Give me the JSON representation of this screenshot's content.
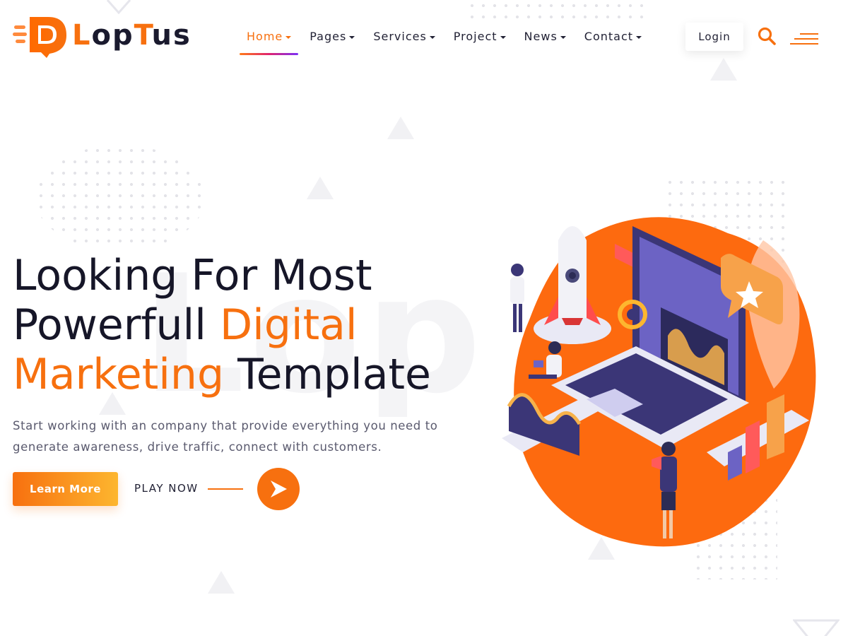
{
  "brand": {
    "name_prefix": "L",
    "name_accent": "o",
    "name_suffix": "pTus",
    "accent_color": "#f7700f"
  },
  "nav": {
    "items": [
      {
        "label": "Home",
        "active": true
      },
      {
        "label": "Pages",
        "active": false
      },
      {
        "label": "Services",
        "active": false
      },
      {
        "label": "Project",
        "active": false
      },
      {
        "label": "News",
        "active": false
      },
      {
        "label": "Contact",
        "active": false
      }
    ]
  },
  "header": {
    "login_label": "Login",
    "search_icon": "search-icon",
    "menu_icon": "hamburger-menu-icon"
  },
  "hero": {
    "title_line1": "Looking For Most",
    "title_line2_plain": "Powerfull ",
    "title_line2_accent": "Digital",
    "title_line3_accent": "Marketing",
    "title_line3_plain": " Template",
    "description": "Start working with an company that provide everything you need to generate awareness, drive traffic, connect with customers.",
    "learn_more_label": "Learn More",
    "play_label": "PLAY NOW",
    "watermark": "LopT"
  },
  "colors": {
    "primary": "#f7700f",
    "gradient_end": "#fdb62f",
    "heading": "#161628",
    "body_text": "#5a5a6e"
  }
}
